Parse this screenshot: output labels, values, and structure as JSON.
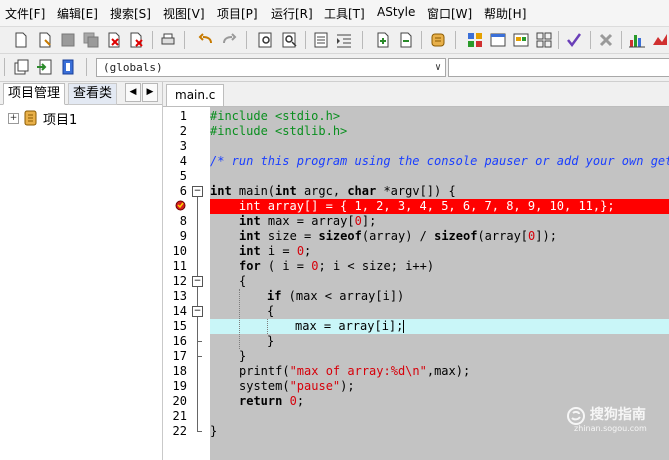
{
  "menu": {
    "file": "文件[F]",
    "edit": "编辑[E]",
    "search": "搜索[S]",
    "view": "视图[V]",
    "project": "项目[P]",
    "run": "运行[R]",
    "tools": "工具[T]",
    "astyle": "AStyle",
    "window": "窗口[W]",
    "help": "帮助[H]"
  },
  "scope_combo": {
    "value": "(globals)"
  },
  "left_panel": {
    "tab_project": "项目管理",
    "tab_classes": "查看类",
    "tree_root": "项目1"
  },
  "editor": {
    "tab": "main.c",
    "breakpoint_line": 7,
    "current_line": 15,
    "lines": [
      "1",
      "2",
      "3",
      "4",
      "5",
      "6",
      "7",
      "8",
      "9",
      "10",
      "11",
      "12",
      "13",
      "14",
      "15",
      "16",
      "17",
      "18",
      "19",
      "20",
      "21",
      "22"
    ]
  },
  "code": {
    "l1": "#include <stdio.h>",
    "l2": "#include <stdlib.h>",
    "l4": "/* run this program using the console pauser or add your own getch",
    "l6_kw1": "int",
    "l6_a": " main(",
    "l6_kw2": "int",
    "l6_b": " argc, ",
    "l6_kw3": "char",
    "l6_c": " *argv[]) {",
    "l7": "    int array[] = { 1, 2, 3, 4, 5, 6, 7, 8, 9, 10, 11,};",
    "l8_kw": "int",
    "l8_a": " max = array[",
    "l8_n": "0",
    "l8_b": "];",
    "l9_kw1": "int",
    "l9_a": " size = ",
    "l9_kw2": "sizeof",
    "l9_b": "(array) / ",
    "l9_kw3": "sizeof",
    "l9_c": "(array[",
    "l9_n": "0",
    "l9_d": "]);",
    "l10_kw": "int",
    "l10_a": " i = ",
    "l10_n": "0",
    "l10_b": ";",
    "l11_kw": "for",
    "l11_a": " ( i = ",
    "l11_n": "0",
    "l11_b": "; i < size; i++)",
    "l12": "{",
    "l13_kw": "if",
    "l13_a": " (max < array[i])",
    "l14": "{",
    "l15": "max = array[i];",
    "l16": "}",
    "l17": "}",
    "l18_a": "printf(",
    "l18_s": "\"max of array:%d\\n\"",
    "l18_b": ",max);",
    "l19_a": "system(",
    "l19_s": "\"pause\"",
    "l19_b": ");",
    "l20_kw": "return",
    "l20_n": " 0",
    "l20_b": ";",
    "l22": "}"
  },
  "watermark": {
    "title": "搜狗指南",
    "url": "zhinan.sogou.com"
  },
  "colors": {
    "breakpoint": "#ff0000",
    "current_line": "#c9f6f8",
    "preprocessor": "#0a8f1f",
    "comment": "#1a3fff",
    "string": "#d6000a",
    "code_bg": "#c3c3c3"
  }
}
